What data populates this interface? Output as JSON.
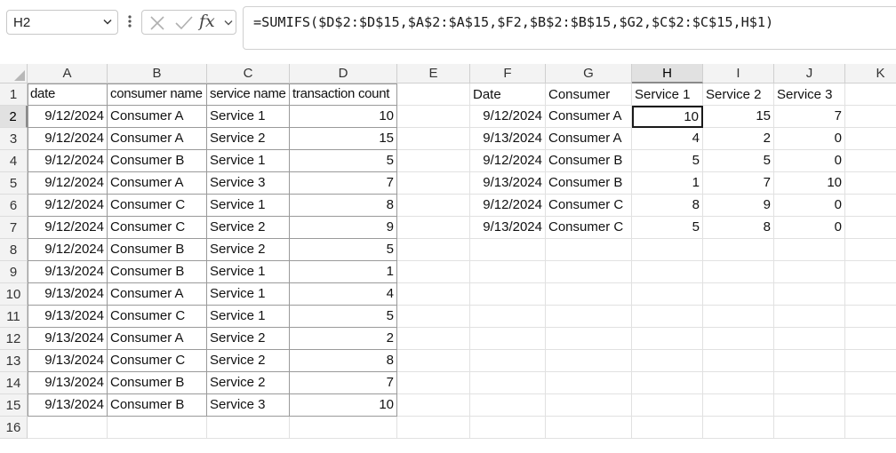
{
  "name_box": {
    "value": "H2"
  },
  "formula_bar": {
    "cancel_icon": "x-icon",
    "enter_icon": "check-icon",
    "fx_label": "fx",
    "formula": "=SUMIFS($D$2:$D$15,$A$2:$A$15,$F2,$B$2:$B$15,$G2,$C$2:$C$15,H$1)"
  },
  "columns": [
    "A",
    "B",
    "C",
    "D",
    "E",
    "F",
    "G",
    "H",
    "I",
    "J",
    "K"
  ],
  "rows": [
    "1",
    "2",
    "3",
    "4",
    "5",
    "6",
    "7",
    "8",
    "9",
    "10",
    "11",
    "12",
    "13",
    "14",
    "15",
    "16"
  ],
  "selected_cell": {
    "column": "H",
    "row": "2"
  },
  "source_table": {
    "headers": [
      "date",
      "consumer name",
      "service name",
      "transaction count"
    ],
    "rows": [
      [
        "9/12/2024",
        "Consumer A",
        "Service 1",
        "10"
      ],
      [
        "9/12/2024",
        "Consumer A",
        "Service 2",
        "15"
      ],
      [
        "9/12/2024",
        "Consumer B",
        "Service 1",
        "5"
      ],
      [
        "9/12/2024",
        "Consumer A",
        "Service 3",
        "7"
      ],
      [
        "9/12/2024",
        "Consumer C",
        "Service 1",
        "8"
      ],
      [
        "9/12/2024",
        "Consumer C",
        "Service 2",
        "9"
      ],
      [
        "9/12/2024",
        "Consumer B",
        "Service 2",
        "5"
      ],
      [
        "9/13/2024",
        "Consumer B",
        "Service 1",
        "1"
      ],
      [
        "9/13/2024",
        "Consumer A",
        "Service 1",
        "4"
      ],
      [
        "9/13/2024",
        "Consumer C",
        "Service 1",
        "5"
      ],
      [
        "9/13/2024",
        "Consumer A",
        "Service 2",
        "2"
      ],
      [
        "9/13/2024",
        "Consumer C",
        "Service 2",
        "8"
      ],
      [
        "9/13/2024",
        "Consumer B",
        "Service 2",
        "7"
      ],
      [
        "9/13/2024",
        "Consumer B",
        "Service 3",
        "10"
      ]
    ]
  },
  "summary_table": {
    "headers": [
      "Date",
      "Consumer",
      "Service 1",
      "Service 2",
      "Service 3"
    ],
    "rows": [
      [
        "9/12/2024",
        "Consumer A",
        "10",
        "15",
        "7"
      ],
      [
        "9/13/2024",
        "Consumer A",
        "4",
        "2",
        "0"
      ],
      [
        "9/12/2024",
        "Consumer B",
        "5",
        "5",
        "0"
      ],
      [
        "9/13/2024",
        "Consumer B",
        "1",
        "7",
        "10"
      ],
      [
        "9/12/2024",
        "Consumer C",
        "8",
        "9",
        "0"
      ],
      [
        "9/13/2024",
        "Consumer C",
        "5",
        "8",
        "0"
      ]
    ]
  }
}
